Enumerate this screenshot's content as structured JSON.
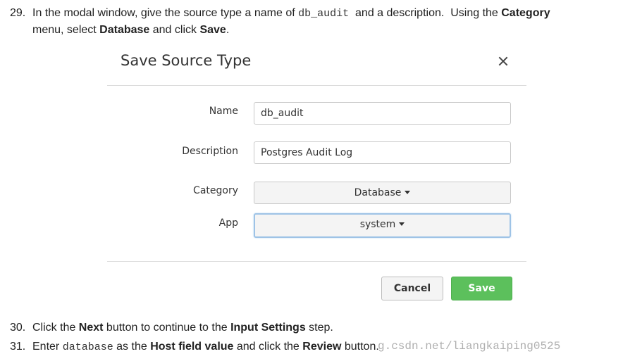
{
  "instructions": {
    "step29": {
      "number": "29.",
      "t1": "In the modal window, give the source type a name of ",
      "code": "db_audit",
      "t2": "  and a description.  Using the ",
      "b1": "Category",
      "t3": "menu, select ",
      "b2": "Database",
      "t4": " and click ",
      "b3": "Save",
      "t5": "."
    },
    "step30": {
      "number": "30.",
      "t1": "Click the ",
      "b1": "Next",
      "t2": " button to continue to the ",
      "b2": "Input Settings",
      "t3": " step."
    },
    "step31": {
      "number": "31.",
      "t1": "Enter ",
      "code": "database",
      "t2": " as the ",
      "b1": "Host field value",
      "t3": " and click the ",
      "b2": "Review",
      "t4": " button."
    }
  },
  "modal": {
    "title": "Save Source Type",
    "fields": {
      "name": {
        "label": "Name",
        "value": "db_audit"
      },
      "description": {
        "label": "Description",
        "value": "Postgres Audit Log"
      },
      "category": {
        "label": "Category",
        "selected": "Database"
      },
      "app": {
        "label": "App",
        "selected": "system"
      }
    },
    "buttons": {
      "cancel": "Cancel",
      "save": "Save"
    }
  },
  "colors": {
    "save_button": "#5cc05c",
    "focus_ring": "#9ec3e6"
  },
  "watermark": "g.csdn.net/liangkaiping0525"
}
